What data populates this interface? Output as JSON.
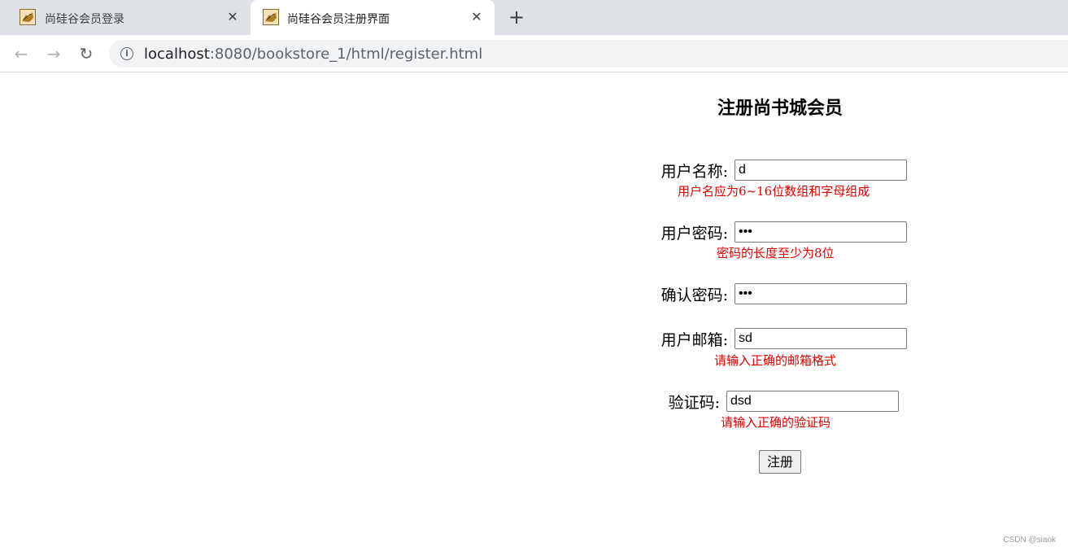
{
  "browser": {
    "tabs": [
      {
        "title": "尚硅谷会员登录",
        "close": "✕"
      },
      {
        "title": "尚硅谷会员注册界面",
        "close": "✕"
      }
    ],
    "new_tab": "+",
    "url_host": "localhost",
    "url_rest": ":8080/bookstore_1/html/register.html"
  },
  "form": {
    "title": "注册尚书城会员",
    "username": {
      "label": "用户名称:",
      "value": "d",
      "error": "用户名应为6~16位数组和字母组成"
    },
    "password": {
      "label": "用户密码:",
      "value": "•••",
      "error": "密码的长度至少为8位"
    },
    "confirm": {
      "label": "确认密码:",
      "value": "•••"
    },
    "email": {
      "label": "用户邮箱:",
      "value": "sd",
      "error": "请输入正确的邮箱格式"
    },
    "captcha": {
      "label": "验证码:",
      "value": "dsd",
      "error": "请输入正确的验证码"
    },
    "submit_label": "注册"
  },
  "watermark": "CSDN @siaok"
}
